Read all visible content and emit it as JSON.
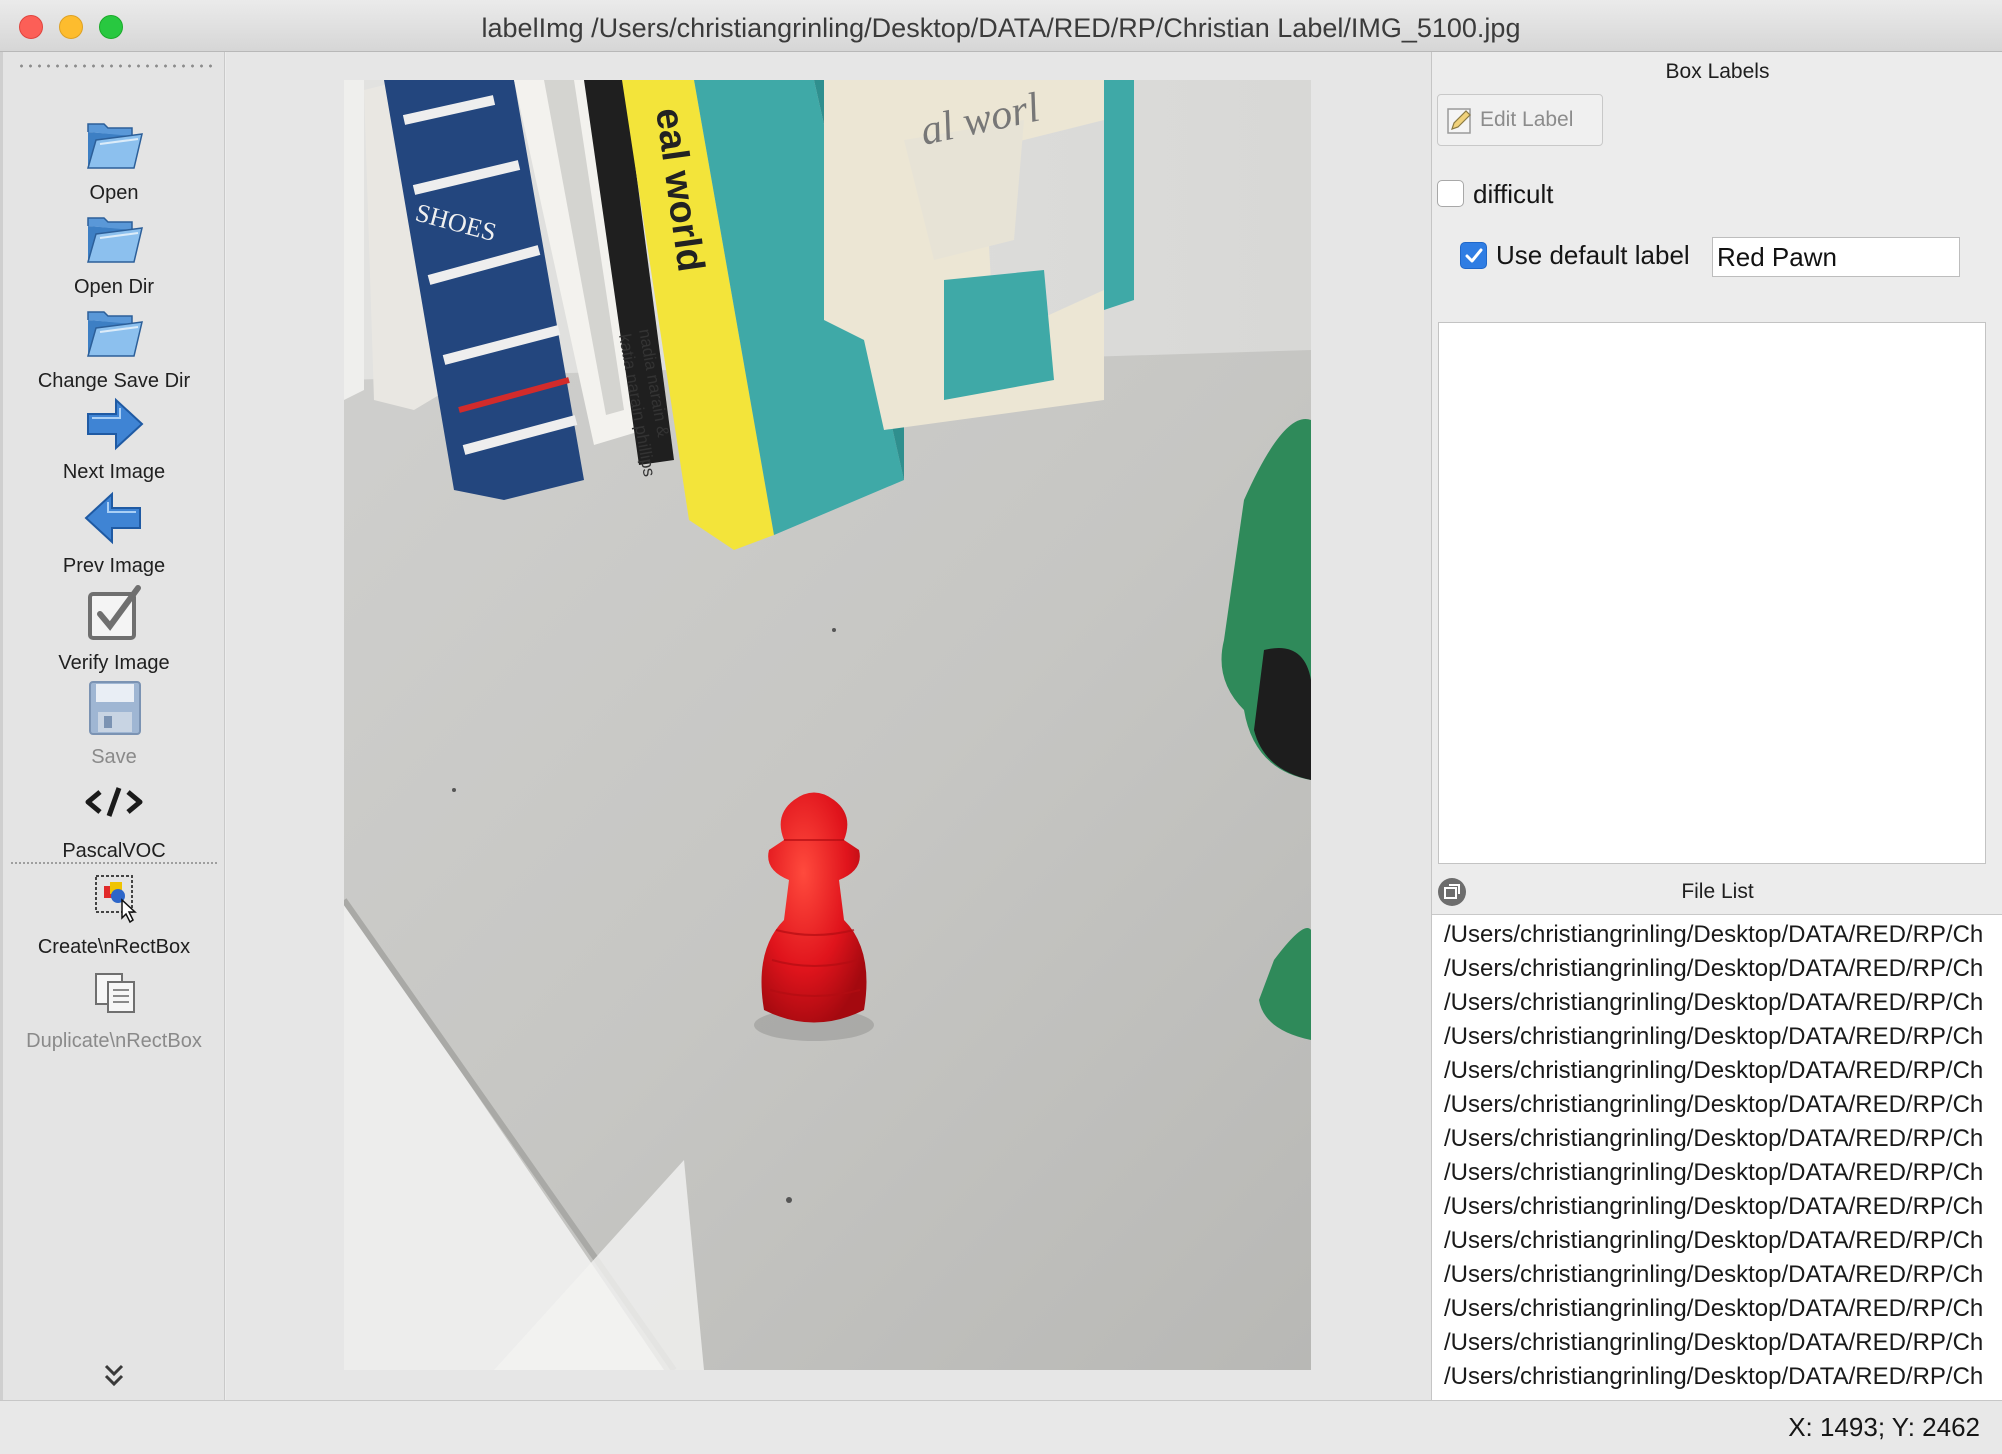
{
  "window": {
    "title": "labelImg /Users/christiangrinling/Desktop/DATA/RED/RP/Christian Label/IMG_5100.jpg"
  },
  "toolbar": {
    "items": [
      {
        "label": "Open",
        "icon": "folder-open-icon",
        "enabled": true
      },
      {
        "label": "Open Dir",
        "icon": "folder-open-icon",
        "enabled": true
      },
      {
        "label": "Change Save Dir",
        "icon": "folder-open-icon",
        "enabled": true
      },
      {
        "label": "Next Image",
        "icon": "arrow-right-icon",
        "enabled": true
      },
      {
        "label": "Prev Image",
        "icon": "arrow-left-icon",
        "enabled": true
      },
      {
        "label": "Verify Image",
        "icon": "checkbox-icon",
        "enabled": true
      },
      {
        "label": "Save",
        "icon": "floppy-disk-icon",
        "enabled": false
      },
      {
        "label": "PascalVOC",
        "icon": "code-tag-icon",
        "enabled": true
      },
      {
        "label": "Create\\nRectBox",
        "icon": "create-rectbox-icon",
        "enabled": true
      },
      {
        "label": "Duplicate\\nRectBox",
        "icon": "duplicate-rectbox-icon",
        "enabled": false
      }
    ]
  },
  "box_labels": {
    "title": "Box Labels",
    "edit_label_button": "Edit Label",
    "difficult_label": "difficult",
    "difficult_checked": false,
    "use_default_label": "Use default label",
    "use_default_checked": true,
    "default_label_value": "Red Pawn"
  },
  "file_list": {
    "title": "File List",
    "items": [
      "/Users/christiangrinling/Desktop/DATA/RED/RP/Ch",
      "/Users/christiangrinling/Desktop/DATA/RED/RP/Ch",
      "/Users/christiangrinling/Desktop/DATA/RED/RP/Ch",
      "/Users/christiangrinling/Desktop/DATA/RED/RP/Ch",
      "/Users/christiangrinling/Desktop/DATA/RED/RP/Ch",
      "/Users/christiangrinling/Desktop/DATA/RED/RP/Ch",
      "/Users/christiangrinling/Desktop/DATA/RED/RP/Ch",
      "/Users/christiangrinling/Desktop/DATA/RED/RP/Ch",
      "/Users/christiangrinling/Desktop/DATA/RED/RP/Ch",
      "/Users/christiangrinling/Desktop/DATA/RED/RP/Ch",
      "/Users/christiangrinling/Desktop/DATA/RED/RP/Ch",
      "/Users/christiangrinling/Desktop/DATA/RED/RP/Ch",
      "/Users/christiangrinling/Desktop/DATA/RED/RP/Ch",
      "/Users/christiangrinling/Desktop/DATA/RED/RP/Ch"
    ]
  },
  "status": {
    "coordinates": "X: 1493; Y: 2462"
  },
  "photo": {
    "book_texts": [
      "SHOES",
      "eal world",
      "al worl",
      "nadia narain &",
      "katia narain phillips"
    ]
  },
  "colors": {
    "accent": "#2f7de3",
    "pawn": "#e0141c",
    "teal_book": "#3fa9a7",
    "yellow_book": "#f3e43a"
  }
}
